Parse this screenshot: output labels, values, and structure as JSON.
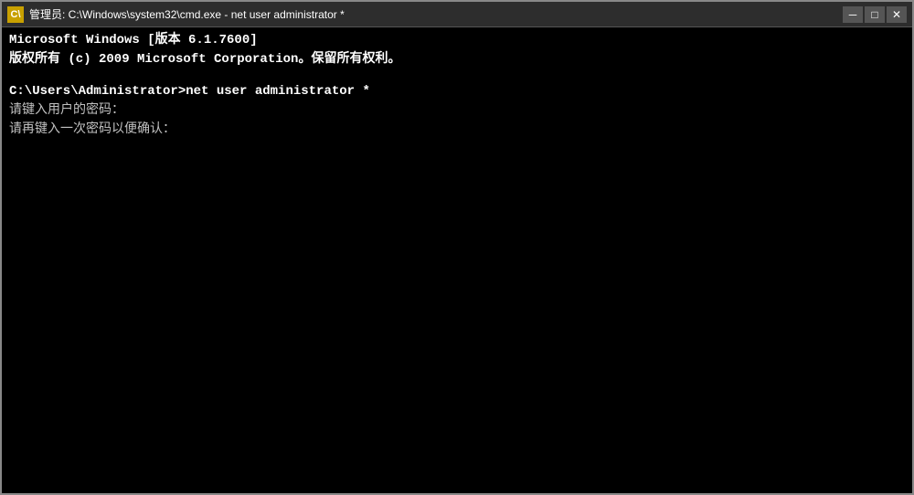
{
  "window": {
    "title": "管理员: C:\\Windows\\system32\\cmd.exe - net user administrator *",
    "icon_label": "C:\\",
    "minimize_label": "─",
    "restore_label": "□",
    "close_label": "✕"
  },
  "terminal": {
    "lines": [
      {
        "text": "Microsoft Windows [版本 6.1.7600]",
        "style": "bold"
      },
      {
        "text": "版权所有 (c) 2009 Microsoft Corporation。保留所有权利。",
        "style": "bold"
      },
      {
        "text": "",
        "style": "spacer"
      },
      {
        "text": "C:\\Users\\Administrator>net user administrator *",
        "style": "bold"
      },
      {
        "text": "请键入用户的密码：",
        "style": "normal"
      },
      {
        "text": "请再键入一次密码以便确认：",
        "style": "normal"
      }
    ]
  }
}
